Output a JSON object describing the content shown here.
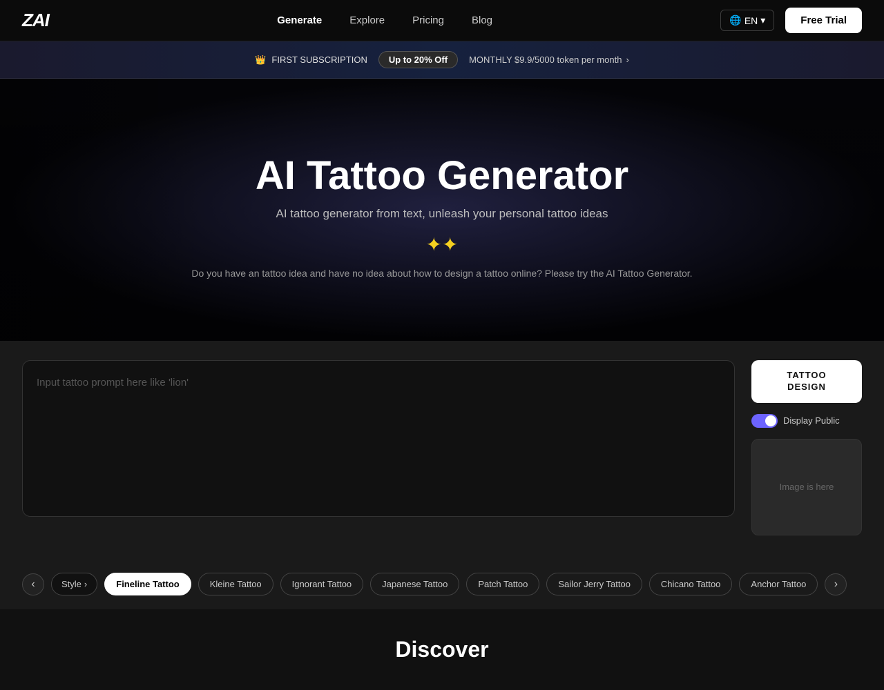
{
  "nav": {
    "logo": "ZAI",
    "links": [
      {
        "label": "Generate",
        "active": true
      },
      {
        "label": "Explore",
        "active": false
      },
      {
        "label": "Pricing",
        "active": false
      },
      {
        "label": "Blog",
        "active": false
      }
    ],
    "lang": "EN",
    "free_trial_label": "Free Trial"
  },
  "promo": {
    "badge_label": "FIRST SUBSCRIPTION",
    "pill_label": "Up to 20% Off",
    "cta_label": "MONTHLY $9.9/5000 token per month"
  },
  "hero": {
    "title": "AI Tattoo Generator",
    "subtitle": "AI tattoo generator from text, unleash your personal tattoo ideas",
    "sparkle": "✦✦",
    "desc": "Do you have an tattoo idea and have no idea about how to design a tattoo online? Please try the AI Tattoo Generator."
  },
  "prompt": {
    "placeholder": "Input tattoo prompt here like 'lion'"
  },
  "sidebar": {
    "generate_label": "TATTOO\nDESIGN",
    "toggle_label": "Display Public",
    "image_placeholder": "Image is here"
  },
  "styles": {
    "label": "Style",
    "chips": [
      {
        "label": "Fineline Tattoo",
        "active": true
      },
      {
        "label": "Kleine Tattoo",
        "active": false
      },
      {
        "label": "Ignorant Tattoo",
        "active": false
      },
      {
        "label": "Japanese Tattoo",
        "active": false
      },
      {
        "label": "Patch Tattoo",
        "active": false
      },
      {
        "label": "Sailor Jerry Tattoo",
        "active": false
      },
      {
        "label": "Chicano Tattoo",
        "active": false
      },
      {
        "label": "Anchor Tattoo",
        "active": false
      }
    ]
  },
  "discover": {
    "title": "Discover"
  }
}
